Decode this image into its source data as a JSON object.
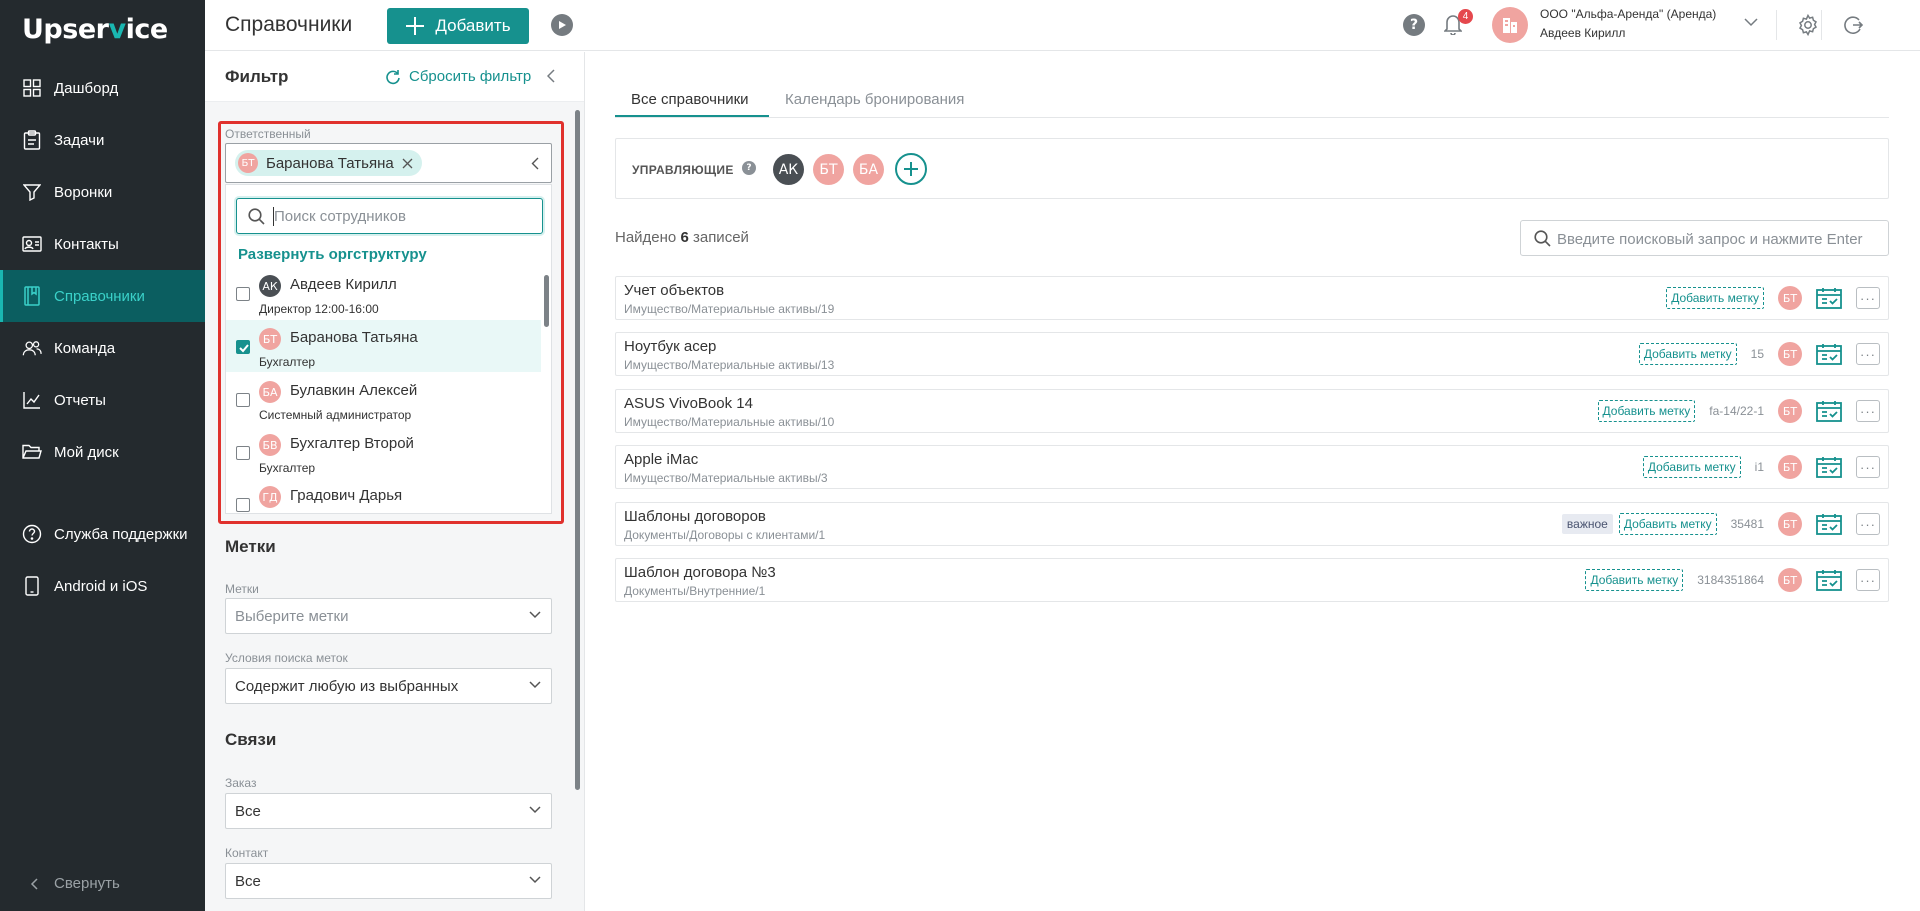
{
  "app": {
    "logo_pre": "Upser",
    "logo_accent": "v",
    "logo_post": "ice"
  },
  "sidebar": {
    "items": [
      {
        "label": "Дашборд",
        "icon": "dashboard-icon"
      },
      {
        "label": "Задачи",
        "icon": "tasks-icon"
      },
      {
        "label": "Воронки",
        "icon": "funnel-icon"
      },
      {
        "label": "Контакты",
        "icon": "contacts-icon"
      },
      {
        "label": "Справочники",
        "icon": "book-icon",
        "active": true
      },
      {
        "label": "Команда",
        "icon": "team-icon"
      },
      {
        "label": "Отчеты",
        "icon": "reports-icon"
      },
      {
        "label": "Мой диск",
        "icon": "folder-icon"
      },
      {
        "label": "Служба поддержки",
        "icon": "support-icon"
      },
      {
        "label": "Android и iOS",
        "icon": "phone-icon"
      }
    ],
    "collapse_label": "Свернуть"
  },
  "topbar": {
    "title": "Справочники",
    "add_label": "Добавить",
    "notifications_count": "4",
    "org_name": "ООО \"Альфа-Аренда\" (Аренда)",
    "user_name": "Авдеев Кирилл"
  },
  "filter": {
    "title": "Фильтр",
    "reset_label": "Сбросить фильтр",
    "responsible": {
      "label": "Ответственный",
      "chip_initials": "БТ",
      "chip_name": "Баранова Татьяна",
      "search_placeholder": "Поиск сотрудников",
      "expand_label": "Развернуть оргструктуру",
      "employees": [
        {
          "initials": "АК",
          "name": "Авдеев Кирилл",
          "position": "Директор 12:00-16:00",
          "checked": false
        },
        {
          "initials": "БТ",
          "name": "Баранова Татьяна",
          "position": "Бухгалтер",
          "checked": true
        },
        {
          "initials": "БА",
          "name": "Булавкин Алексей",
          "position": "Системный администратор",
          "checked": false
        },
        {
          "initials": "БВ",
          "name": "Бухгалтер Второй",
          "position": "Бухгалтер",
          "checked": false
        },
        {
          "initials": "ГД",
          "name": "Градович Дарья",
          "position": "",
          "checked": false
        }
      ]
    },
    "tags_section": "Метки",
    "tags_label": "Метки",
    "tags_placeholder": "Выберите метки",
    "tag_condition_label": "Условия поиска меток",
    "tag_condition_value": "Содержит любую из выбранных",
    "links_section": "Связи",
    "order_label": "Заказ",
    "order_value": "Все",
    "contact_label": "Контакт",
    "contact_value": "Все"
  },
  "main": {
    "tabs": [
      {
        "label": "Все справочники",
        "active": true
      },
      {
        "label": "Календарь бронирования",
        "active": false
      }
    ],
    "managers_label": "УПРАВЛЯЮЩИЕ",
    "managers": [
      "АК",
      "БТ",
      "БА"
    ],
    "found_prefix": "Найдено",
    "found_count": "6",
    "found_suffix": "записей",
    "search_placeholder": "Введите поисковый запрос и нажмите Enter",
    "add_tag_label": "Добавить метку",
    "rows": [
      {
        "title": "Учет объектов",
        "path": "Имущество/Материальные активы/19",
        "tag": "",
        "code": "",
        "owner": "БТ"
      },
      {
        "title": "Ноутбук асер",
        "path": "Имущество/Материальные активы/13",
        "tag": "",
        "code": "15",
        "owner": "БТ"
      },
      {
        "title": "ASUS VivoBook 14",
        "path": "Имущество/Материальные активы/10",
        "tag": "",
        "code": "fa-14/22-1",
        "owner": "БТ"
      },
      {
        "title": "Apple iMac",
        "path": "Имущество/Материальные активы/3",
        "tag": "",
        "code": "i1",
        "owner": "БТ"
      },
      {
        "title": "Шаблоны договоров",
        "path": "Документы/Договоры с клиентами/1",
        "tag": "важное",
        "code": "35481",
        "owner": "БТ"
      },
      {
        "title": "Шаблон договора №3",
        "path": "Документы/Внутренние/1",
        "tag": "",
        "code": "3184351864",
        "owner": "БТ"
      }
    ]
  },
  "colors": {
    "accent": "#16918e",
    "sidebar": "#242a2e",
    "avatar_pink": "#f0a4a0",
    "avatar_dark": "#4a4f54",
    "highlight": "#e0312d"
  }
}
